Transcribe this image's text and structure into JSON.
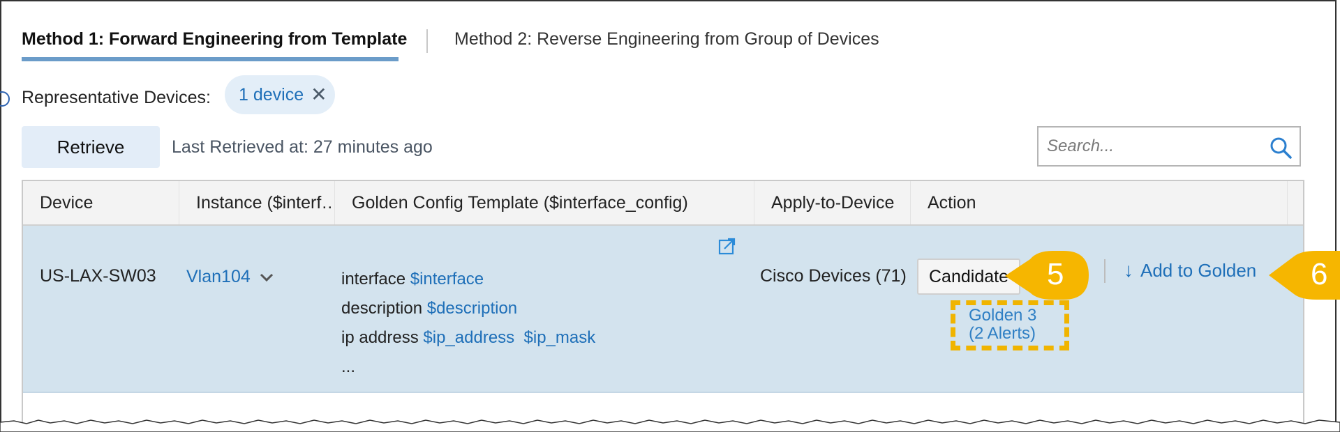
{
  "tabs": [
    {
      "label": "Method 1: Forward Engineering from Template",
      "active": true
    },
    {
      "label": "Method 2: Reverse Engineering from Group of Devices",
      "active": false
    }
  ],
  "representative": {
    "label": "Representative Devices:",
    "chip_label": "1 device",
    "chip_close": "✕"
  },
  "toolbar": {
    "retrieve_label": "Retrieve",
    "last_retrieved": "Last Retrieved at: 27 minutes ago"
  },
  "search": {
    "placeholder": "Search..."
  },
  "table": {
    "headers": [
      "Device",
      "Instance ($interf…",
      "Golden Config Template ($interface_config)",
      "Apply-to-Device",
      "Action"
    ],
    "row": {
      "device": "US-LAX-SW03",
      "instance": "Vlan104",
      "template": [
        {
          "text": "interface",
          "vars": [
            "$interface"
          ]
        },
        {
          "text": "description",
          "vars": [
            "$description"
          ]
        },
        {
          "text": "ip address",
          "vars": [
            "$ip_address",
            "$ip_mask"
          ]
        },
        {
          "text": "...",
          "vars": []
        }
      ],
      "apply_to": "Cisco Devices (71)",
      "candidate_label": "Candidate",
      "golden_line1": "Golden 3",
      "golden_line2": "(2 Alerts)",
      "add_golden": "Add to Golden"
    }
  },
  "callouts": {
    "five": "5",
    "six": "6"
  },
  "colors": {
    "accent": "#1e6fb8",
    "callout": "#f6b600",
    "row_bg": "#d3e3ee",
    "tab_underline": "#6b9cc9"
  }
}
